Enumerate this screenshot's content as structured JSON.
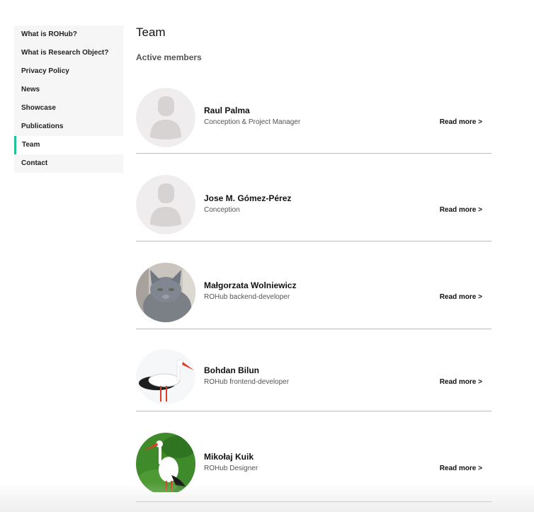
{
  "sidebar": {
    "items": [
      {
        "label": "What is ROHub?"
      },
      {
        "label": "What is Research Object?"
      },
      {
        "label": "Privacy Policy"
      },
      {
        "label": "News"
      },
      {
        "label": "Showcase"
      },
      {
        "label": "Publications"
      },
      {
        "label": "Team",
        "active": true
      },
      {
        "label": "Contact"
      }
    ]
  },
  "main": {
    "title": "Team",
    "section_title": "Active members",
    "read_more_label": "Read more >",
    "members": [
      {
        "name": "Raul Palma",
        "role": "Conception & Project Manager",
        "avatar": "placeholder-person-icon"
      },
      {
        "name": "Jose M. Gómez-Pérez",
        "role": "Conception",
        "avatar": "placeholder-person-icon"
      },
      {
        "name": "Małgorzata Wolniewicz",
        "role": "ROHub backend-developer",
        "avatar": "gray-cat-photo"
      },
      {
        "name": "Bohdan Bilun",
        "role": "ROHub frontend-developer",
        "avatar": "stork-photo"
      },
      {
        "name": "Mikołaj Kuik",
        "role": "ROHub Designer",
        "avatar": "stork-on-grass-photo"
      }
    ]
  },
  "colors": {
    "accent": "#1ec398",
    "sidebar_bg": "#f6f6f6",
    "divider": "#bcbcbc"
  }
}
